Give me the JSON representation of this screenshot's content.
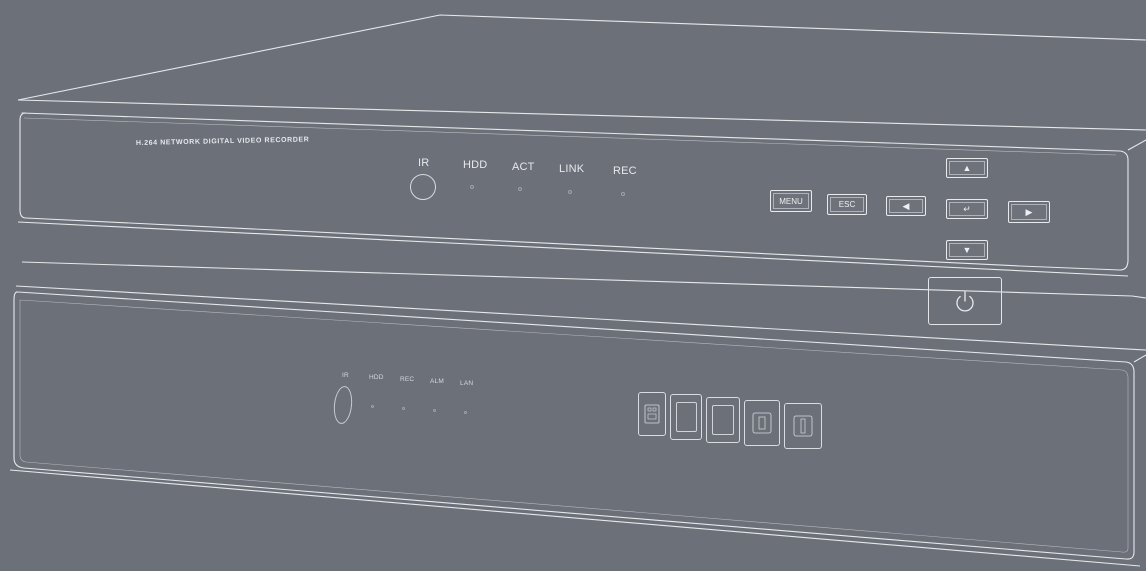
{
  "upper_unit": {
    "brand_text": "H.264 NETWORK DIGITAL VIDEO RECORDER",
    "ir_label": "IR",
    "indicators": [
      {
        "label": "HDD"
      },
      {
        "label": "ACT"
      },
      {
        "label": "LINK"
      },
      {
        "label": "REC"
      }
    ],
    "buttons": {
      "menu": "MENU",
      "esc": "ESC",
      "left": "◀",
      "enter": "↵",
      "right": "▶",
      "up": "▲",
      "down": "▼"
    },
    "power_icon": "power-icon"
  },
  "lower_unit": {
    "ir_label": "IR",
    "indicators": [
      {
        "label": "HDD"
      },
      {
        "label": "REC"
      },
      {
        "label": "ALM"
      },
      {
        "label": "LAN"
      }
    ],
    "ports": [
      "card-slot-icon",
      "port-icon",
      "port-icon",
      "usb-port-icon",
      "usb-port-icon"
    ]
  },
  "colors": {
    "background": "#6b7079",
    "outline": "#e8eaed"
  }
}
